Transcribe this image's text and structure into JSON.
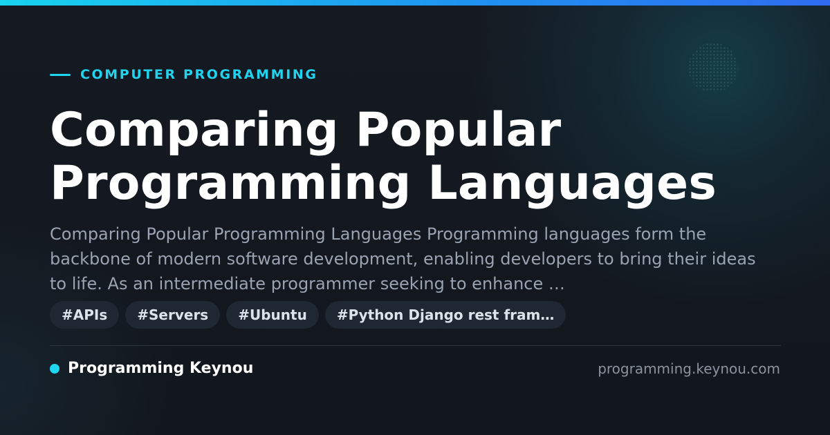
{
  "colors": {
    "accent": "#22d3ee",
    "background": "#141820",
    "tag_background": "#1e2732",
    "title": "#ffffff",
    "excerpt": "#9aa3b1"
  },
  "kicker": {
    "label": "COMPUTER PROGRAMMING"
  },
  "title": {
    "line1": "Comparing Popular",
    "line2": "Programming Languages"
  },
  "excerpt": "Comparing Popular Programming Languages Programming languages form the backbone of modern software development, enabling developers to bring their ideas to life. As an intermediate programmer seeking to enhance …",
  "tags": [
    {
      "label": "#APIs"
    },
    {
      "label": "#Servers"
    },
    {
      "label": "#Ubuntu"
    },
    {
      "label": "#Python Django rest fram…"
    }
  ],
  "footer": {
    "brand": "Programming Keynou",
    "domain": "programming.keynou.com"
  }
}
